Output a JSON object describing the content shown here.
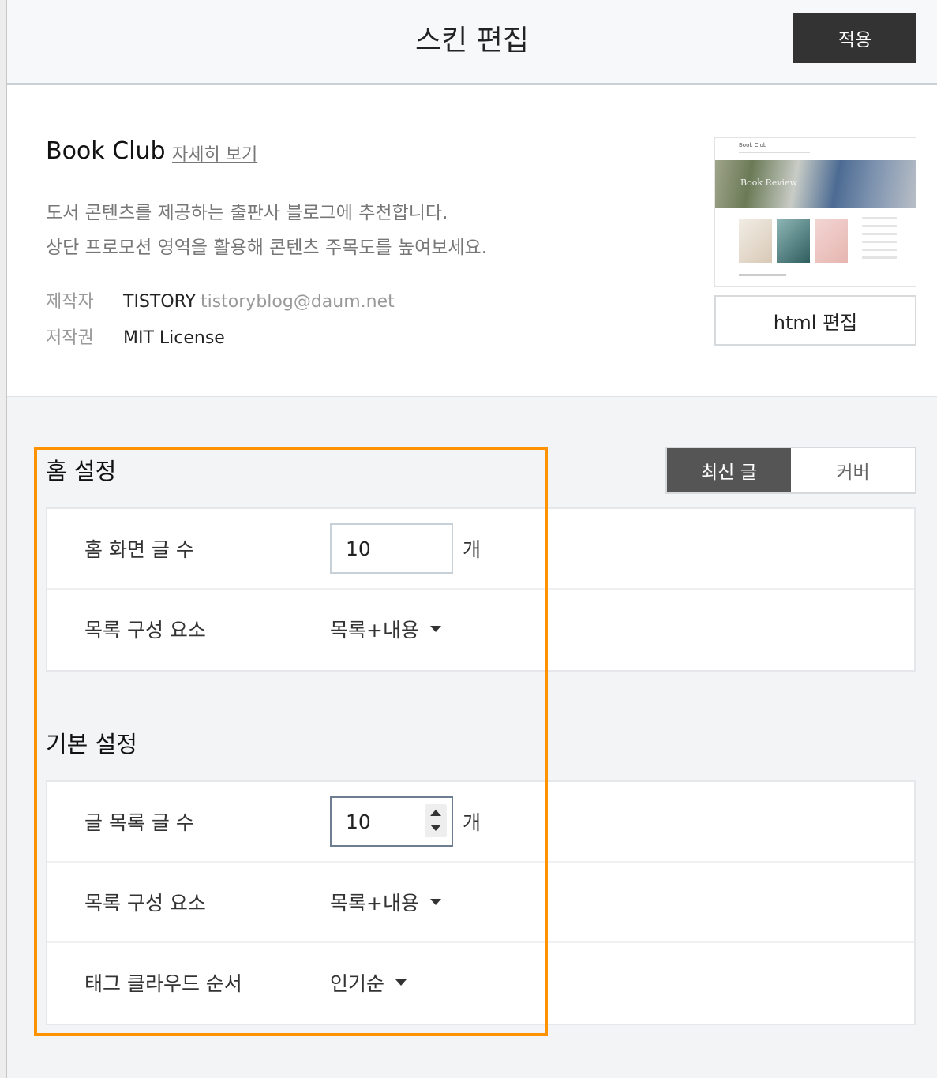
{
  "header": {
    "title": "스킨 편집",
    "apply_label": "적용"
  },
  "skin": {
    "name": "Book Club",
    "detail_link": "자세히 보기",
    "description_line1": "도서 콘텐츠를 제공하는 출판사 블로그에 추천합니다.",
    "description_line2": "상단 프로모션 영역을 활용해 콘텐츠 주목도를 높여보세요.",
    "author_label": "제작자",
    "author_name": "TISTORY",
    "author_email": "tistoryblog@daum.net",
    "license_label": "저작권",
    "license_value": "MIT License",
    "preview": {
      "site_title": "Book Club",
      "banner_text": "Book Review"
    },
    "html_edit_label": "html 편집"
  },
  "home_settings": {
    "title": "홈 설정",
    "tabs": [
      {
        "label": "최신 글",
        "active": true
      },
      {
        "label": "커버",
        "active": false
      }
    ],
    "rows": {
      "post_count_label": "홈 화면 글 수",
      "post_count_value": "10",
      "unit": "개",
      "list_component_label": "목록 구성 요소",
      "list_component_value": "목록+내용"
    }
  },
  "basic_settings": {
    "title": "기본 설정",
    "rows": {
      "list_count_label": "글 목록 글 수",
      "list_count_value": "10",
      "unit": "개",
      "list_component_label": "목록 구성 요소",
      "list_component_value": "목록+내용",
      "tag_cloud_label": "태그 클라우드 순서",
      "tag_cloud_value": "인기순"
    }
  },
  "colors": {
    "highlight": "#ff9200",
    "dark_button": "#333333",
    "active_tab": "#555555"
  }
}
